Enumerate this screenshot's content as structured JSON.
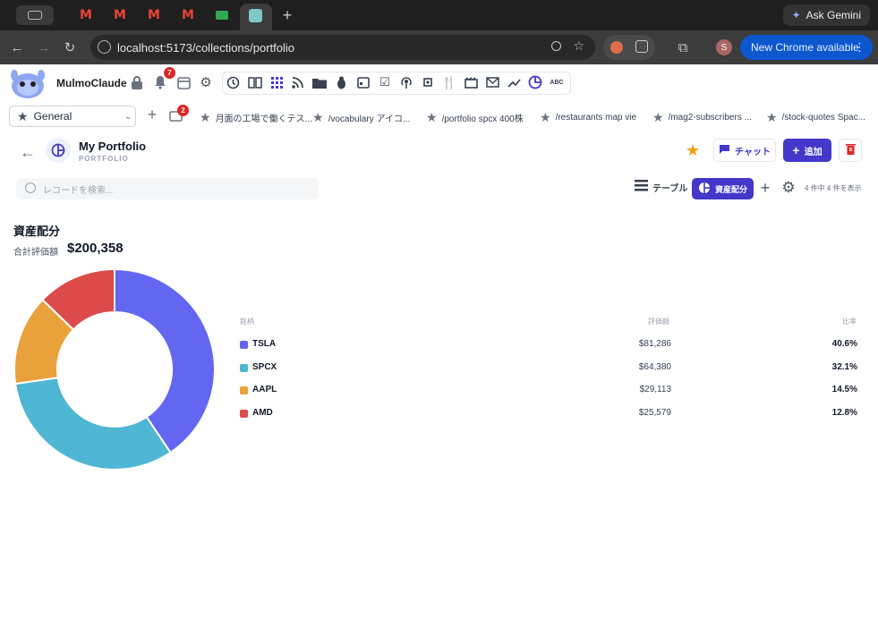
{
  "browser": {
    "ask_gemini": "Ask Gemini",
    "url": "localhost:5173/collections/portfolio",
    "new_chrome": "New Chrome available",
    "profile_initial": "S"
  },
  "app": {
    "brand": "MulmoClaude",
    "notification_count": "7",
    "files_badge": "2",
    "workspace": "General"
  },
  "bookmarks": [
    {
      "label": "月面の工場で働くテス..."
    },
    {
      "label": "/vocabulary アイコ..."
    },
    {
      "label": "/portfolio spcx 400株"
    },
    {
      "label": "/restaurants map vie"
    },
    {
      "label": "/mag2-subscribers ..."
    },
    {
      "label": "/stock-quotes Spac..."
    }
  ],
  "page": {
    "title": "My Portfolio",
    "subtitle": "PORTFOLIO",
    "chat_label": "チャット",
    "add_label": "追加",
    "search_placeholder": "レコードを検索...",
    "view_table_label": "テーブル",
    "view_chart_label": "資産配分",
    "count_text": "4 件中 4 件を表示"
  },
  "summary": {
    "heading": "資産配分",
    "total_label": "合計評価額",
    "total_value": "$200,358"
  },
  "table": {
    "col_name": "銘柄",
    "col_value": "評価額",
    "col_ratio": "比率",
    "rows": [
      {
        "symbol": "TSLA",
        "value": "$81,286",
        "ratio": "40.6%",
        "color": "#6366f1"
      },
      {
        "symbol": "SPCX",
        "value": "$64,380",
        "ratio": "32.1%",
        "color": "#4fb6d3"
      },
      {
        "symbol": "AAPL",
        "value": "$29,113",
        "ratio": "14.5%",
        "color": "#e9a23b"
      },
      {
        "symbol": "AMD",
        "value": "$25,579",
        "ratio": "12.8%",
        "color": "#dc4a4a"
      }
    ]
  },
  "chart_data": {
    "type": "pie",
    "categories": [
      "TSLA",
      "SPCX",
      "AAPL",
      "AMD"
    ],
    "values": [
      81286,
      64380,
      29113,
      25579
    ],
    "colors": [
      "#6366f1",
      "#4fb6d3",
      "#e9a23b",
      "#dc4a4a"
    ]
  }
}
